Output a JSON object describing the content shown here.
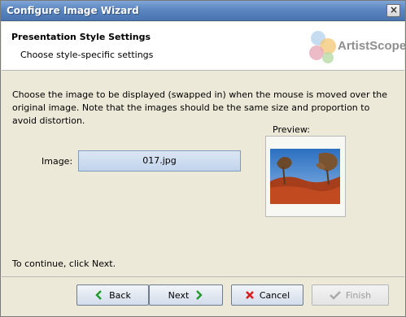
{
  "window": {
    "title": "Configure Image Wizard"
  },
  "header": {
    "title": "Presentation Style Settings",
    "subtitle": "Choose style-specific settings",
    "logo_text": "ArtistScope"
  },
  "main": {
    "description": "Choose the image to be displayed (swapped in) when the mouse is moved over the original image. Note that the images should be the same size and proportion to avoid distortion.",
    "image_label": "Image:",
    "image_value": "017.jpg",
    "preview_label": "Preview:",
    "continue_text": "To continue, click Next."
  },
  "buttons": {
    "back": "Back",
    "next": "Next",
    "cancel": "Cancel",
    "finish": "Finish"
  },
  "colors": {
    "title_bar": "#5b86c0",
    "back_next_icon": "#1f9a2a",
    "cancel_icon": "#d61f1f",
    "finish_disabled": "#9a9a9a"
  }
}
